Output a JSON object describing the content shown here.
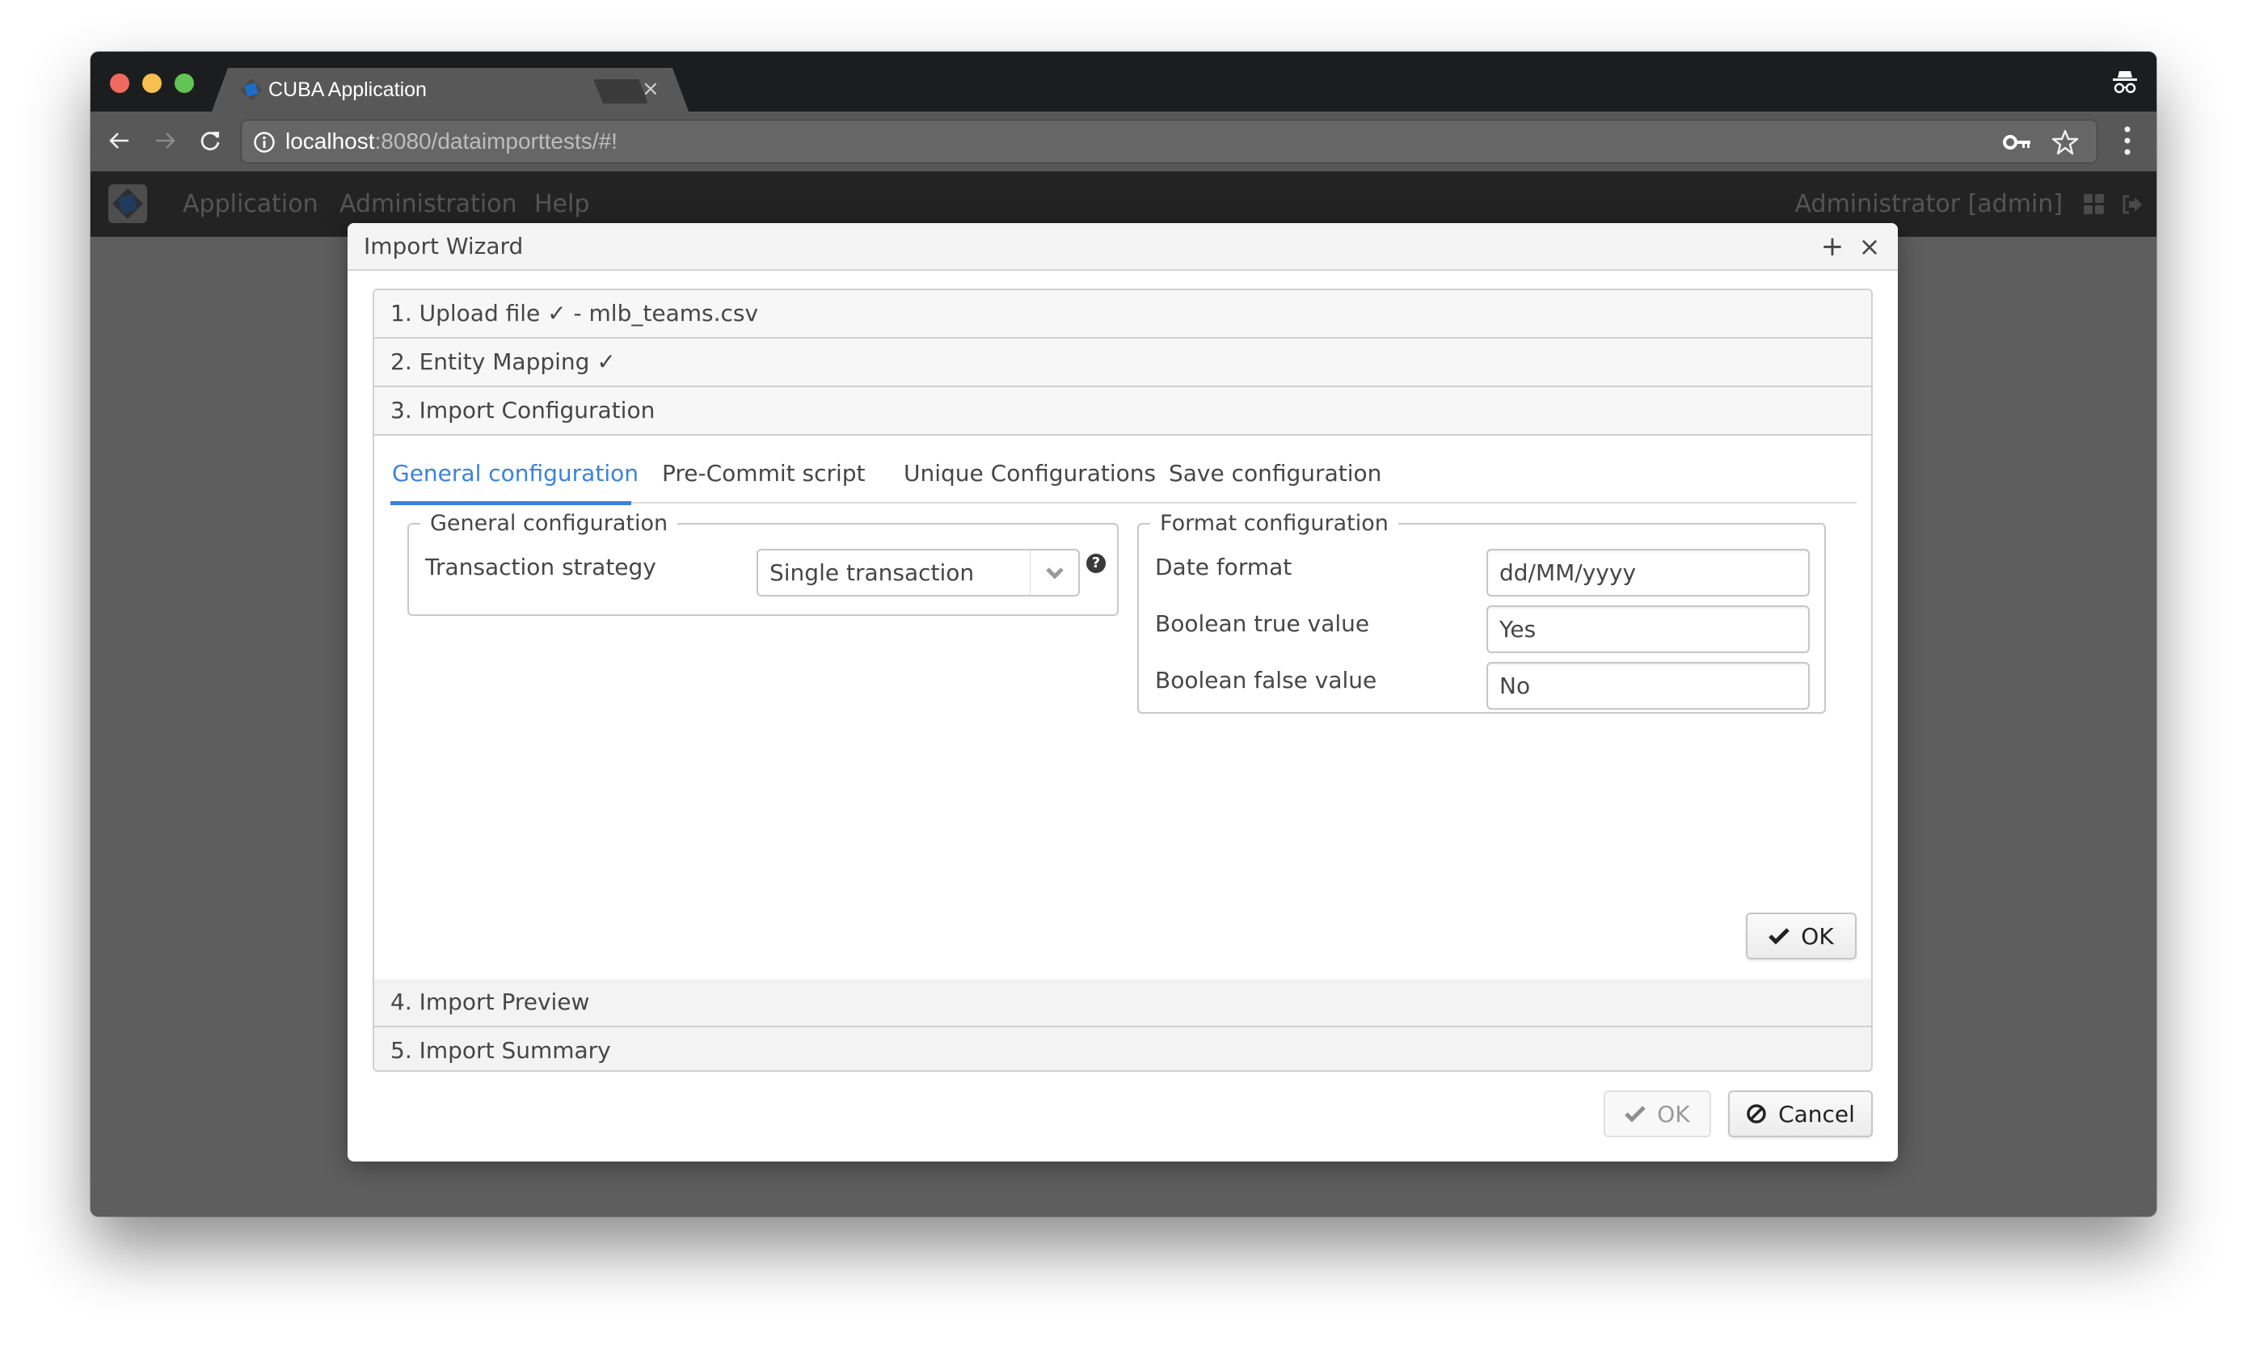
{
  "browser": {
    "tab_title": "CUBA Application",
    "tab_close": "×",
    "url_host": "localhost",
    "url_rest": ":8080/dataimporttests/#!",
    "icons": [
      "back-icon",
      "forward-icon",
      "reload-icon",
      "info-icon",
      "key-icon",
      "star-icon",
      "menu-icon",
      "incognito-icon"
    ]
  },
  "app": {
    "menu": [
      "Application",
      "Administration",
      "Help"
    ],
    "user": "Administrator [admin]",
    "icons": [
      "app-logo",
      "grid-icon",
      "logout-icon"
    ]
  },
  "dialog": {
    "title": "Import Wizard",
    "maximize_glyph": "+",
    "close_glyph": "×",
    "steps": [
      {
        "label": "1. Upload file ✓ - mlb_teams.csv",
        "expanded": false
      },
      {
        "label": "2. Entity Mapping ✓",
        "expanded": false
      },
      {
        "label": "3. Import Configuration",
        "expanded": true
      },
      {
        "label": "4. Import Preview",
        "expanded": false
      },
      {
        "label": "5. Import Summary",
        "expanded": false
      }
    ],
    "tabs": [
      {
        "label": "General configuration",
        "active": true
      },
      {
        "label": "Pre-Commit script",
        "active": false
      },
      {
        "label": "Unique Configurations",
        "active": false
      },
      {
        "label": "Save configuration",
        "active": false
      }
    ],
    "general": {
      "legend": "General configuration",
      "transaction_label": "Transaction strategy",
      "transaction_value": "Single transaction",
      "help_glyph": "?"
    },
    "format": {
      "legend": "Format configuration",
      "fields": [
        {
          "label": "Date format",
          "value": "dd/MM/yyyy"
        },
        {
          "label": "Boolean true value",
          "value": "Yes"
        },
        {
          "label": "Boolean false value",
          "value": "No"
        }
      ]
    },
    "step_ok_label": "OK",
    "footer": {
      "ok_label": "OK",
      "ok_disabled": true,
      "cancel_label": "Cancel"
    }
  },
  "colors": {
    "accent": "#3b82dc",
    "traffic_red": "#ee6a5f",
    "traffic_yellow": "#f5bf4f",
    "traffic_green": "#61c454"
  }
}
